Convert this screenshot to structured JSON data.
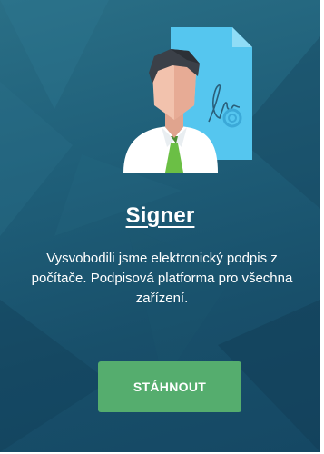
{
  "app": {
    "title": "Signer",
    "description": "Vysvobodili jsme elektronický podpis z počítače. Podpisová platforma pro všechna zařízení.",
    "download_button_label": "STÁHNOUT"
  },
  "icons": {
    "hero_illustration": "signer-user-with-signed-document-icon"
  },
  "colors": {
    "background": "#1f5f79",
    "button": "#55ad6e",
    "text": "#ffffff"
  }
}
